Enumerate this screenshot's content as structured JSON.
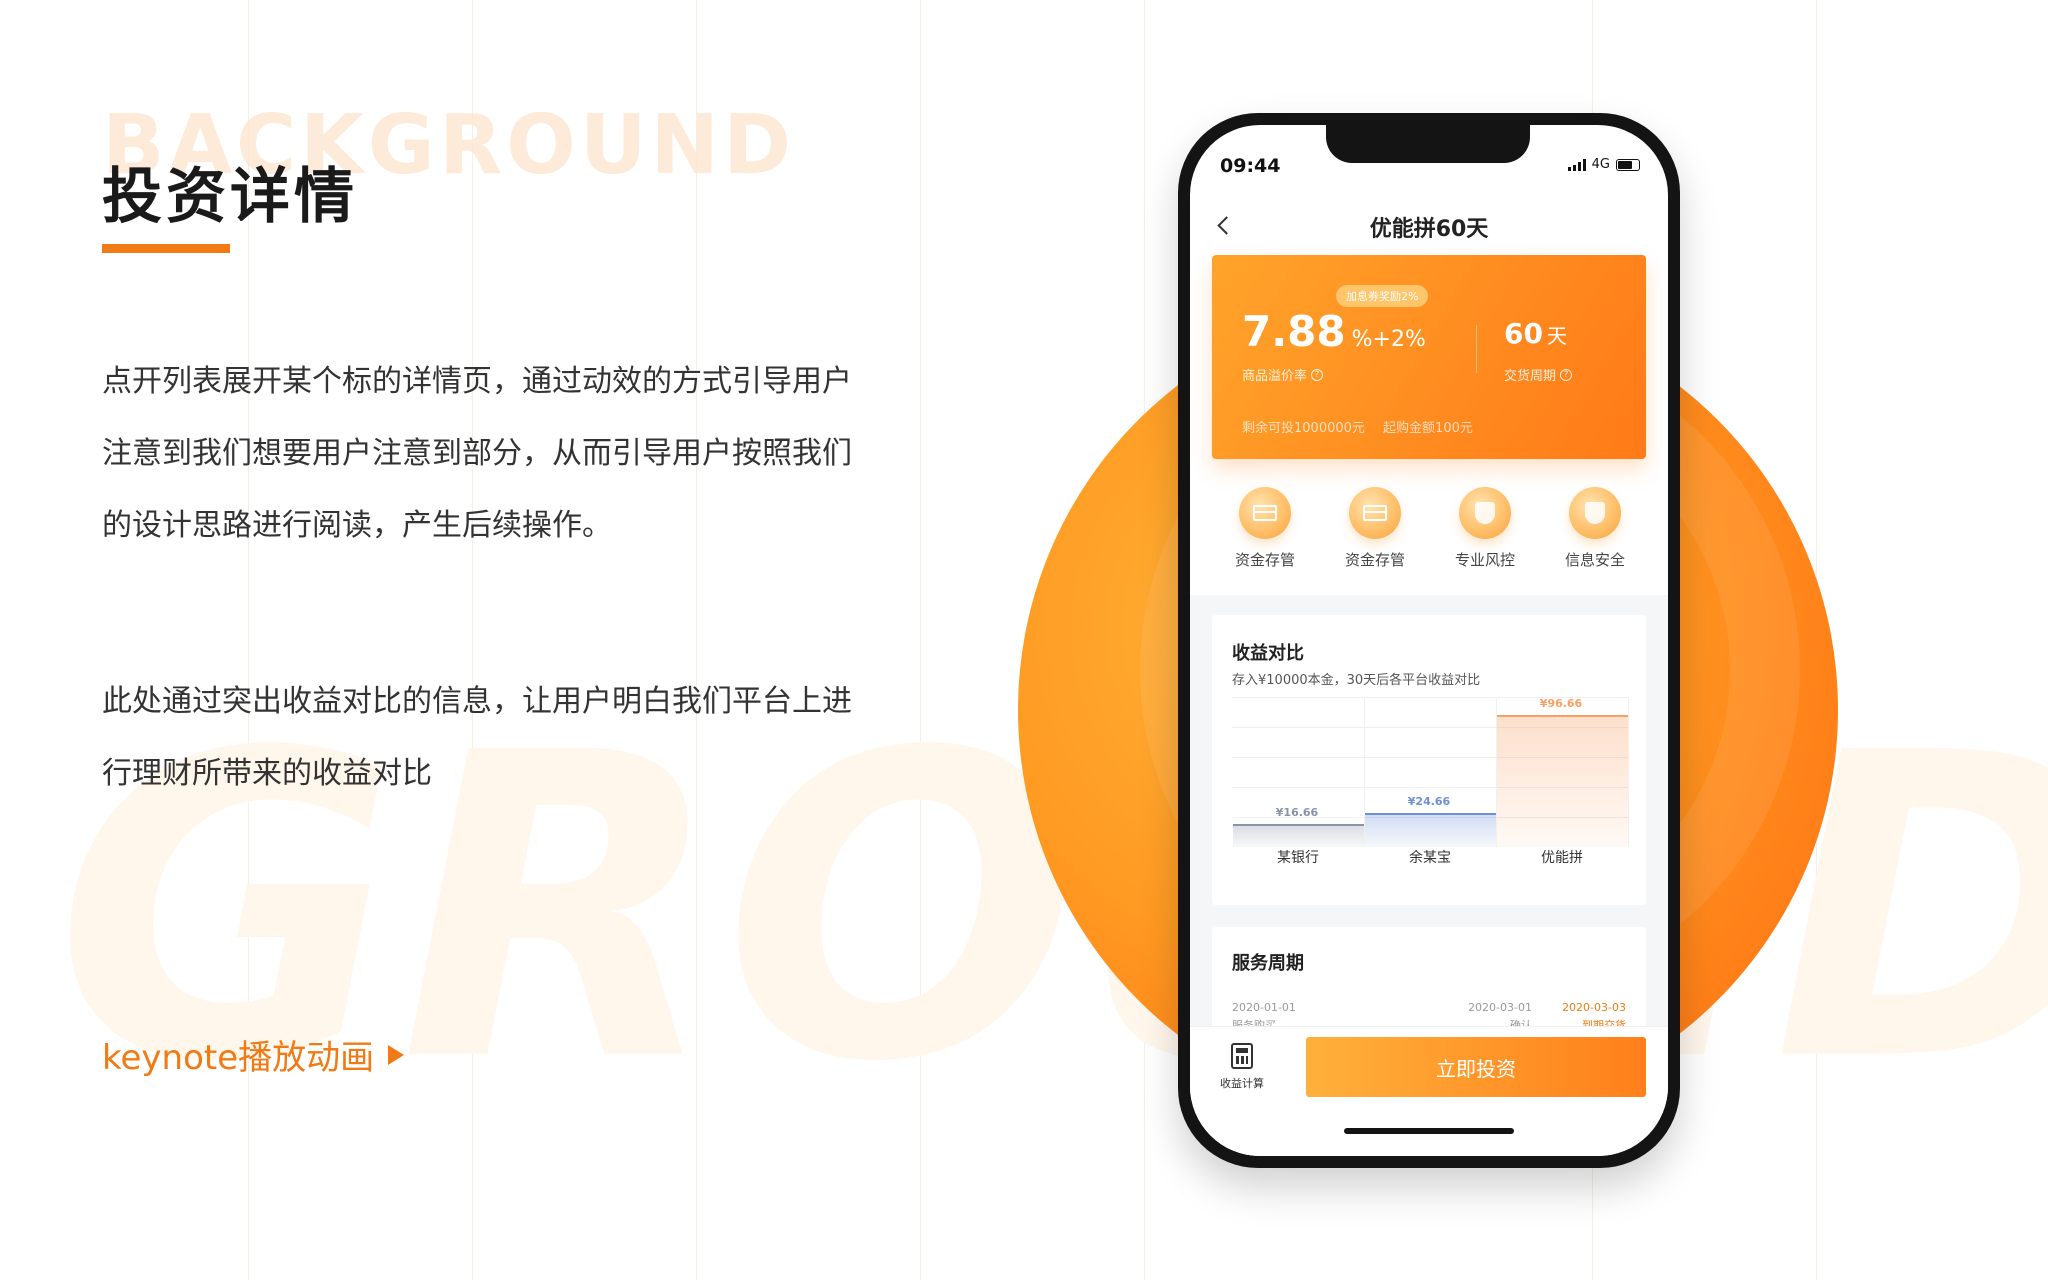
{
  "slide": {
    "bg_word_top": "BACKGROUND",
    "bg_word_big": "GROUND",
    "title": "投资详情",
    "para1_line1": "点开列表展开某个标的详情页，通过动效的方式引导用户",
    "para1_line2": "注意到我们想要用户注意到部分，从而引导用户按照我们",
    "para1_line3": "的设计思路进行阅读，产生后续操作。",
    "para2_line1": "此处通过突出收益对比的信息，让用户明白我们平台上进",
    "para2_line2": "行理财所带来的收益对比",
    "keynote_link": "keynote播放动画",
    "accent_color": "#f27a14"
  },
  "phone": {
    "status_time": "09:44",
    "network": "4G",
    "nav_title": "优能拼60天",
    "hero": {
      "bonus_tag": "加息券奖励2%",
      "rate": "7.88",
      "rate_suffix": "%+2%",
      "rate_label": "商品溢价率",
      "days": "60",
      "days_unit": "天",
      "days_label": "交货周期",
      "remaining": "剩余可投1000000元",
      "min_amount": "起购金额100元"
    },
    "features": [
      {
        "label": "资金存管",
        "icon": "card-icon"
      },
      {
        "label": "资金存管",
        "icon": "card-icon"
      },
      {
        "label": "专业风控",
        "icon": "badge-icon"
      },
      {
        "label": "信息安全",
        "icon": "shield-icon"
      }
    ],
    "compare": {
      "title": "收益对比",
      "subtitle": "存入¥10000本金，30天后各平台收益对比"
    },
    "service": {
      "title": "服务周期",
      "start_date": "2020-01-01",
      "start_label": "服务购买",
      "confirm_date": "2020-03-01",
      "confirm_label": "确认",
      "deliver_date": "2020-03-03",
      "deliver_label": "到期交货"
    },
    "bottom": {
      "calc_label": "收益计算",
      "invest_button": "立即投资"
    }
  },
  "chart_data": {
    "type": "bar",
    "categories": [
      "某银行",
      "余某宝",
      "优能拼"
    ],
    "values": [
      16.66,
      24.66,
      96.66
    ],
    "value_labels": [
      "¥16.66",
      "¥24.66",
      "¥96.66"
    ],
    "title": "收益对比",
    "subtitle": "存入¥10000本金，30天后各平台收益对比",
    "ylim": [
      0,
      110
    ],
    "grid": true,
    "colors": [
      "#8a94a6",
      "#6f8fd8",
      "#f7a064"
    ]
  }
}
